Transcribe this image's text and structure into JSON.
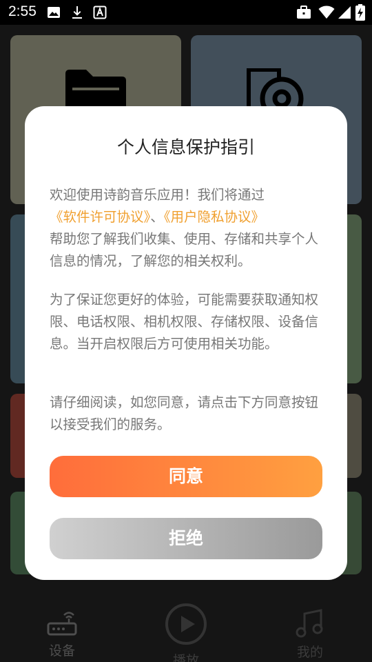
{
  "status_bar": {
    "time": "2:55",
    "icons": [
      "image-icon",
      "download-icon",
      "text-a-icon",
      "briefcase-icon",
      "wifi-icon",
      "signal-icon",
      "battery-charging-icon"
    ]
  },
  "background": {
    "tiles": [
      {
        "icon": "folder-icon",
        "color": "#8c8b78"
      },
      {
        "icon": "music-file-icon",
        "color": "#5f7282"
      },
      {
        "icon": "",
        "color": "#4f6c7c"
      },
      {
        "icon": "",
        "color": "#688262"
      },
      {
        "icon": "",
        "color": "#8b3c31"
      },
      {
        "icon": "",
        "color": "#716d5e"
      },
      {
        "icon": "",
        "color": "#4a6e4f"
      },
      {
        "icon": "",
        "color": "#4f6a4e"
      }
    ],
    "nav": {
      "device_label": "设备",
      "play_label": "播放",
      "mine_label": "我的"
    }
  },
  "dialog": {
    "title": "个人信息保护指引",
    "para1_before": "欢迎使用诗韵音乐应用！我们将通过",
    "link_license": "《软件许可协议》",
    "separator": "、",
    "link_privacy": "《用户隐私协议》",
    "para1_after": "帮助您了解我们收集、使用、存储和共享个人信息的情况，了解您的相关权利。",
    "para2": "为了保证您更好的体验，可能需要获取通知权限、电话权限、相机权限、存储权限、设备信息。当开启权限后方可使用相关功能。",
    "para3": "请仔细阅读，如您同意，请点击下方同意按钮以接受我们的服务。",
    "agree_label": "同意",
    "refuse_label": "拒绝"
  },
  "colors": {
    "link": "#f0a030",
    "agree_start": "#ff6d3b",
    "agree_end": "#ffa040",
    "refuse_start": "#d0d0d0",
    "refuse_end": "#9a9a9a"
  }
}
